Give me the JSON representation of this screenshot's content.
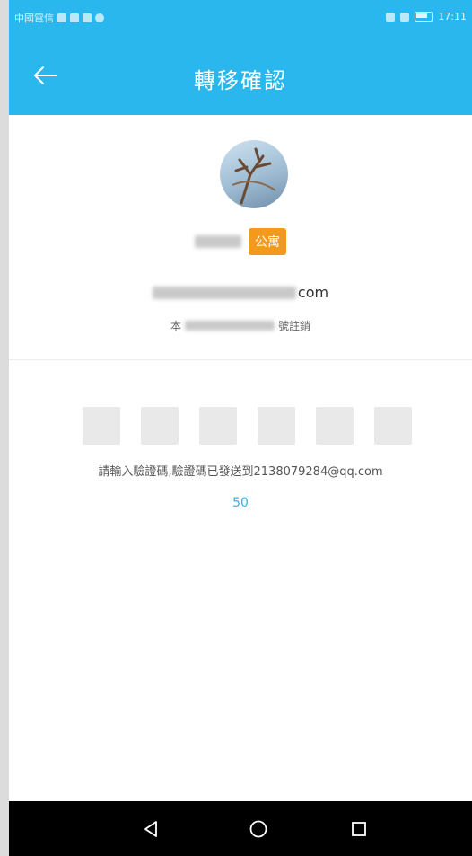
{
  "status_bar": {
    "carrier": "中國電信",
    "time": "17:11"
  },
  "header": {
    "title": "轉移確認",
    "back_icon": "arrow-left-icon"
  },
  "account": {
    "badge": "公寓",
    "email_suffix": "com",
    "hint_prefix": "本",
    "hint_suffix": "號註銷"
  },
  "verification": {
    "code_length": 6,
    "instruction": "請輸入驗證碼,驗證碼已發送到2138079284@qq.com",
    "countdown": "50"
  },
  "nav_bar": {
    "back_icon": "triangle-back-icon",
    "home_icon": "circle-home-icon",
    "recents_icon": "square-recents-icon"
  },
  "colors": {
    "primary": "#2ab7ee",
    "badge": "#f39a1e",
    "code_box": "#e9e9e9"
  }
}
